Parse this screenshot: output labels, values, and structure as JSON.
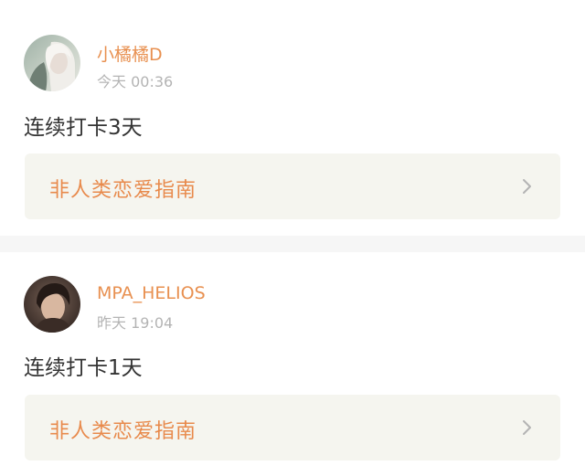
{
  "posts": [
    {
      "username": "小橘橘D",
      "timestamp": "今天 00:36",
      "text": "连续打卡3天",
      "topic": "非人类恋爱指南"
    },
    {
      "username": "MPA_HELIOS",
      "timestamp": "昨天 19:04",
      "text": "连续打卡1天",
      "topic": "非人类恋爱指南"
    }
  ],
  "icons": {
    "topic_chevron": "chevron-right-icon"
  },
  "colors": {
    "username": "#e89050",
    "topic": "#e88a4c",
    "tab_indicator": "#f06a94",
    "timestamp": "#b4b4b4",
    "card_bg": "#f5f5ef"
  }
}
